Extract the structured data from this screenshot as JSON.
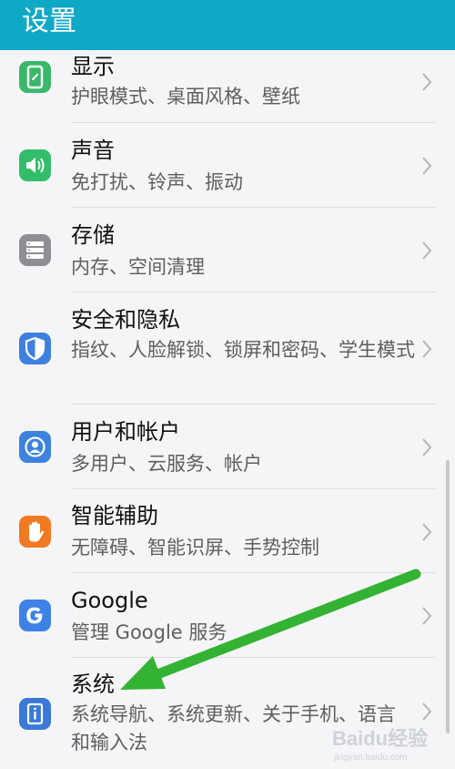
{
  "header": {
    "title": "设置"
  },
  "items": [
    {
      "title": "显示",
      "subtitle": "护眼模式、桌面风格、壁纸",
      "icon": "display-icon",
      "color": "#39b86a"
    },
    {
      "title": "声音",
      "subtitle": "免打扰、铃声、振动",
      "icon": "sound-icon",
      "color": "#33bd6a"
    },
    {
      "title": "存储",
      "subtitle": "内存、空间清理",
      "icon": "storage-icon",
      "color": "#8e8e93"
    },
    {
      "title": "安全和隐私",
      "subtitle": "指纹、人脸解锁、锁屏和密码、学生模式",
      "icon": "shield-icon",
      "color": "#3e7fe0"
    },
    {
      "title": "用户和帐户",
      "subtitle": "多用户、云服务、帐户",
      "icon": "user-icon",
      "color": "#3d83de"
    },
    {
      "title": "智能辅助",
      "subtitle": "无障碍、智能识屏、手势控制",
      "icon": "hand-icon",
      "color": "#f07a22"
    },
    {
      "title": "Google",
      "subtitle": "管理 Google 服务",
      "icon": "google-icon",
      "color": "#3f82e6"
    },
    {
      "title": "系统",
      "subtitle": "系统导航、系统更新、关于手机、语言和输入法",
      "icon": "system-info-icon",
      "color": "#3a79d8"
    }
  ],
  "annotation": {
    "arrow_color": "#34b233"
  },
  "watermark": {
    "brand": "Baidu经验",
    "url": "jingyan.baidu.com"
  }
}
